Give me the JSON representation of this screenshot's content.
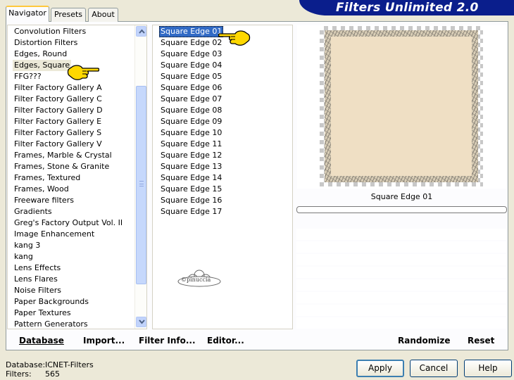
{
  "app_title": "Filters Unlimited 2.0",
  "tabs": [
    {
      "label": "Navigator",
      "active": true
    },
    {
      "label": "Presets",
      "active": false
    },
    {
      "label": "About",
      "active": false
    }
  ],
  "categories": [
    "Convolution Filters",
    "Distortion Filters",
    "Edges, Round",
    "Edges, Square",
    "FFG???",
    "Filter Factory Gallery A",
    "Filter Factory Gallery C",
    "Filter Factory Gallery D",
    "Filter Factory Gallery E",
    "Filter Factory Gallery S",
    "Filter Factory Gallery V",
    "Frames, Marble & Crystal",
    "Frames, Stone & Granite",
    "Frames, Textured",
    "Frames, Wood",
    "Freeware filters",
    "Gradients",
    "Greg's Factory Output Vol. II",
    "Image Enhancement",
    "kang 3",
    "kang",
    "Lens Effects",
    "Lens Flares",
    "Noise Filters",
    "Paper Backgrounds",
    "Paper Textures",
    "Pattern Generators"
  ],
  "selected_category": "Edges, Square",
  "filters": [
    "Square Edge 01",
    "Square Edge 02",
    "Square Edge 03",
    "Square Edge 04",
    "Square Edge 05",
    "Square Edge 06",
    "Square Edge 07",
    "Square Edge 08",
    "Square Edge 09",
    "Square Edge 10",
    "Square Edge 11",
    "Square Edge 12",
    "Square Edge 13",
    "Square Edge 14",
    "Square Edge 15",
    "Square Edge 16",
    "Square Edge 17"
  ],
  "selected_filter": "Square Edge 01",
  "watermark": "©pinuccia",
  "preview": {
    "filter_name": "Square Edge 01",
    "frame_color": "#d8cdb6",
    "fill_color": "#efdfc4"
  },
  "bottom_buttons": {
    "database": "Database",
    "import": "Import...",
    "filter_info": "Filter Info...",
    "editor": "Editor...",
    "randomize": "Randomize",
    "reset": "Reset"
  },
  "status": {
    "database_label": "Database:",
    "database_value": "ICNET-Filters",
    "filters_label": "Filters:",
    "filters_value": "565"
  },
  "dialog_buttons": {
    "apply": "Apply",
    "cancel": "Cancel",
    "help": "Help"
  },
  "colors": {
    "banner": "#0a1e8c",
    "selection": "#316ac5",
    "window_bg": "#ece9d8"
  }
}
